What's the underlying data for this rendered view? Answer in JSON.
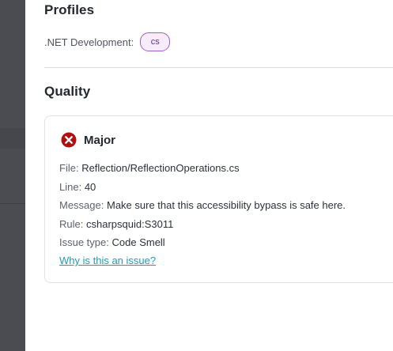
{
  "profiles": {
    "title": "Profiles",
    "items": [
      {
        "label": ".NET Development:",
        "badge": "cs"
      }
    ]
  },
  "quality": {
    "title": "Quality",
    "issue": {
      "severity": "Major",
      "severity_icon": "error-x-circle-icon",
      "severity_color": "#b01010",
      "file_label": "File:",
      "file": "Reflection/ReflectionOperations.cs",
      "line_label": "Line:",
      "line": "40",
      "message_label": "Message:",
      "message": "Make sure that this accessibility bypass is safe here.",
      "rule_label": "Rule:",
      "rule": "csharpsquid:S3011",
      "type_label": "Issue type:",
      "type": "Code Smell",
      "link_text": "Why is this an issue?"
    }
  },
  "colors": {
    "overlay": "#4b4c52",
    "badge_border": "#a35bd1",
    "badge_bg": "#f6ecfb",
    "link": "#1c9db5"
  }
}
